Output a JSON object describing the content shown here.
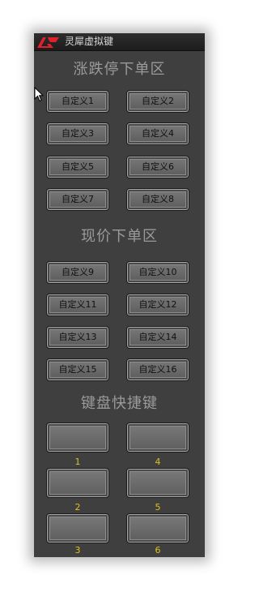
{
  "window": {
    "title": "灵犀虚拟键"
  },
  "sections": {
    "limit": "涨跌停下单区",
    "current": "现价下单区",
    "hotkeys": "键盘快捷键"
  },
  "custom_buttons": [
    "自定义1",
    "自定义2",
    "自定义3",
    "自定义4",
    "自定义5",
    "自定义6",
    "自定义7",
    "自定义8",
    "自定义9",
    "自定义10",
    "自定义11",
    "自定义12",
    "自定义13",
    "自定义14",
    "自定义15",
    "自定义16"
  ],
  "hotkey_labels": [
    "1",
    "4",
    "2",
    "5",
    "3",
    "6"
  ],
  "colors": {
    "brand_red": "#e0212b",
    "key_label": "#e0c020",
    "panel": "#3f3f3f"
  }
}
